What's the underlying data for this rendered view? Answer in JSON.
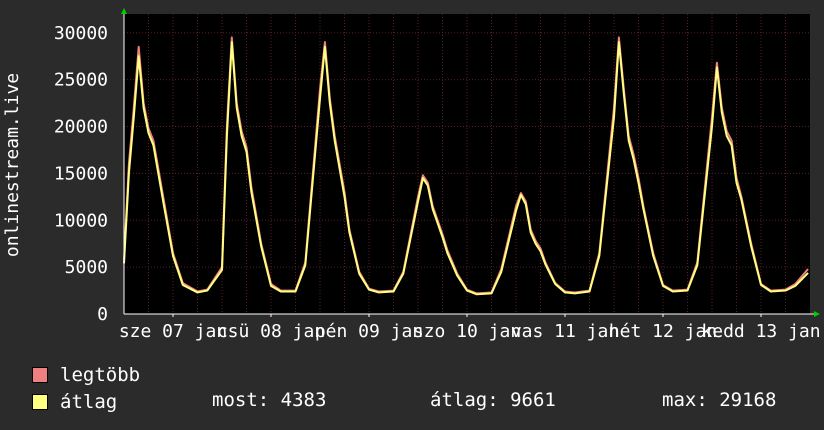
{
  "chart_data": {
    "type": "line",
    "ylabel": "onlinestream.live",
    "ylim": [
      0,
      32000
    ],
    "yticks": [
      0,
      5000,
      10000,
      15000,
      20000,
      25000,
      30000
    ],
    "xticks": [
      "sze 07 jan",
      "csü 08 jan",
      "pén 09 jan",
      "szo 10 jan",
      "vas 11 jan",
      "hét 12 jan",
      "kedd 13 jan"
    ],
    "grid": true,
    "colors": {
      "background": "#000000",
      "grid": "#5a1e1e",
      "axis": "#ffffff",
      "max_series": "#f08080",
      "avg_series": "#ffff80",
      "arrow": "#00cc00"
    },
    "series": [
      {
        "name": "legtöbb",
        "x": [
          0,
          0.05,
          0.1,
          0.15,
          0.2,
          0.25,
          0.3,
          0.4,
          0.5,
          0.6,
          0.75,
          0.85,
          1.0,
          1.05,
          1.1,
          1.15,
          1.2,
          1.25,
          1.3,
          1.4,
          1.5,
          1.6,
          1.75,
          1.85,
          2.0,
          2.05,
          2.1,
          2.15,
          2.2,
          2.25,
          2.3,
          2.4,
          2.5,
          2.6,
          2.75,
          2.85,
          3.0,
          3.05,
          3.1,
          3.15,
          3.2,
          3.25,
          3.3,
          3.4,
          3.5,
          3.6,
          3.75,
          3.85,
          4.0,
          4.05,
          4.1,
          4.15,
          4.2,
          4.25,
          4.3,
          4.4,
          4.5,
          4.6,
          4.75,
          4.85,
          5.0,
          5.05,
          5.1,
          5.15,
          5.2,
          5.25,
          5.3,
          5.4,
          5.5,
          5.6,
          5.75,
          5.85,
          6.0,
          6.05,
          6.1,
          6.15,
          6.2,
          6.25,
          6.3,
          6.4,
          6.5,
          6.6,
          6.75,
          6.85,
          6.98
        ],
        "values": [
          5800,
          16000,
          22000,
          28500,
          22500,
          19800,
          18500,
          12500,
          6500,
          3300,
          2400,
          2600,
          5000,
          20000,
          29500,
          22500,
          19500,
          17800,
          13500,
          7500,
          3200,
          2500,
          2500,
          5500,
          24000,
          29000,
          23000,
          19000,
          16000,
          13000,
          9000,
          4500,
          2700,
          2400,
          2500,
          4500,
          12500,
          14800,
          14000,
          11500,
          10000,
          8500,
          6800,
          4300,
          2600,
          2200,
          2300,
          4800,
          11500,
          12900,
          12000,
          9000,
          7800,
          7000,
          5500,
          3300,
          2400,
          2300,
          2500,
          6500,
          22000,
          29500,
          24000,
          19000,
          17000,
          14500,
          11500,
          6500,
          3100,
          2500,
          2600,
          5500,
          21000,
          26800,
          22000,
          19500,
          18500,
          14500,
          12500,
          7500,
          3200,
          2500,
          2600,
          3200,
          4800
        ]
      },
      {
        "name": "átlag",
        "x": [
          0,
          0.05,
          0.1,
          0.15,
          0.2,
          0.25,
          0.3,
          0.4,
          0.5,
          0.6,
          0.75,
          0.85,
          1.0,
          1.05,
          1.1,
          1.15,
          1.2,
          1.25,
          1.3,
          1.4,
          1.5,
          1.6,
          1.75,
          1.85,
          2.0,
          2.05,
          2.1,
          2.15,
          2.2,
          2.25,
          2.3,
          2.4,
          2.5,
          2.6,
          2.75,
          2.85,
          3.0,
          3.05,
          3.1,
          3.15,
          3.2,
          3.25,
          3.3,
          3.4,
          3.5,
          3.6,
          3.75,
          3.85,
          4.0,
          4.05,
          4.1,
          4.15,
          4.2,
          4.25,
          4.3,
          4.4,
          4.5,
          4.6,
          4.75,
          4.85,
          5.0,
          5.05,
          5.1,
          5.15,
          5.2,
          5.25,
          5.3,
          5.4,
          5.5,
          5.6,
          5.75,
          5.85,
          6.0,
          6.05,
          6.1,
          6.15,
          6.2,
          6.25,
          6.3,
          6.4,
          6.5,
          6.6,
          6.75,
          6.85,
          6.98
        ],
        "values": [
          5400,
          15000,
          21000,
          27500,
          22000,
          19300,
          18000,
          12000,
          6200,
          3100,
          2300,
          2500,
          4700,
          19000,
          29000,
          22000,
          19000,
          17300,
          13000,
          7200,
          3000,
          2400,
          2400,
          5200,
          23000,
          28500,
          22500,
          18500,
          15500,
          12500,
          8700,
          4300,
          2600,
          2300,
          2400,
          4300,
          12000,
          14500,
          13700,
          11200,
          9700,
          8200,
          6500,
          4100,
          2500,
          2100,
          2200,
          4500,
          11000,
          12700,
          11700,
          8700,
          7500,
          6700,
          5300,
          3200,
          2300,
          2200,
          2400,
          6200,
          21000,
          29000,
          23500,
          18500,
          16500,
          14000,
          11200,
          6200,
          3000,
          2400,
          2500,
          5200,
          20000,
          26300,
          21500,
          19000,
          18000,
          14000,
          12200,
          7200,
          3100,
          2400,
          2500,
          3000,
          4383
        ]
      }
    ]
  },
  "legend": {
    "items": [
      {
        "label": "legtöbb",
        "color": "#f08080"
      },
      {
        "label": "átlag",
        "color": "#ffff80"
      }
    ],
    "stats": {
      "most": "most: 4383",
      "atlag": "átlag: 9661",
      "max": "max: 29168"
    }
  }
}
